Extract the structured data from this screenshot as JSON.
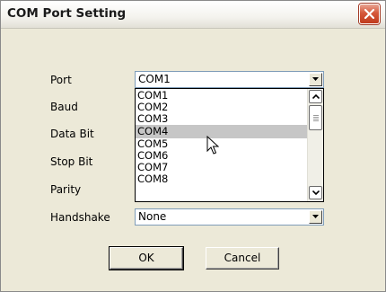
{
  "window": {
    "title": "COM Port Setting"
  },
  "fields": {
    "port": {
      "label": "Port",
      "value": "COM1"
    },
    "baud": {
      "label": "Baud"
    },
    "data_bit": {
      "label": "Data Bit"
    },
    "stop_bit": {
      "label": "Stop Bit"
    },
    "parity": {
      "label": "Parity"
    },
    "handshake": {
      "label": "Handshake",
      "value": "None"
    }
  },
  "port_dropdown": {
    "options": [
      "COM1",
      "COM2",
      "COM3",
      "COM4",
      "COM5",
      "COM6",
      "COM7",
      "COM8"
    ],
    "highlighted": "COM4"
  },
  "buttons": {
    "ok": "OK",
    "cancel": "Cancel"
  },
  "colors": {
    "dialog_bg": "#ece9d8",
    "close_button": "#d5583b",
    "highlight": "#c6c6c6",
    "combo_border": "#7f9db9"
  }
}
